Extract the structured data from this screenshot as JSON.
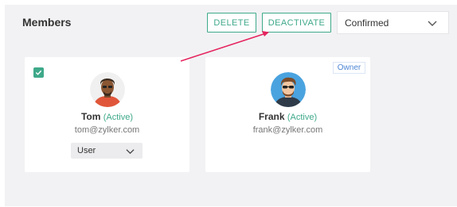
{
  "header": {
    "title": "Members",
    "delete_label": "DELETE",
    "deactivate_label": "DEACTIVATE",
    "filter_value": "Confirmed"
  },
  "members": [
    {
      "name": "Tom",
      "status": "(Active)",
      "email": "tom@zylker.com",
      "role": "User",
      "selected": true
    },
    {
      "name": "Frank",
      "status": "(Active)",
      "email": "frank@zylker.com",
      "badge": "Owner"
    }
  ],
  "colors": {
    "accent": "#3fa98a",
    "annotation_arrow": "#e5245e",
    "owner_badge": "#4d86d6"
  },
  "icons": [
    "chevron-down-icon",
    "checkmark-icon",
    "annotation-arrow"
  ]
}
